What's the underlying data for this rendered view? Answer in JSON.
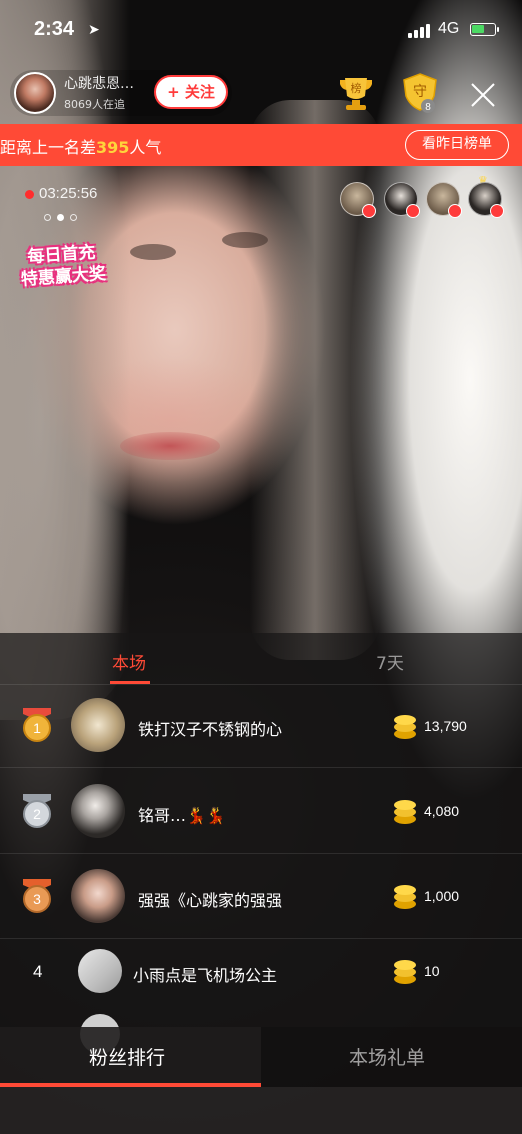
{
  "status_bar": {
    "time": "2:34",
    "network": "4G",
    "location_icon": "location-arrow-icon"
  },
  "host": {
    "name": "心跳悲恩…",
    "followers": "8069人在追",
    "follow_label": "+ 关注"
  },
  "header_icons": {
    "rank_icon_label": "榜",
    "guard_icon_label": "守",
    "guard_count": "8"
  },
  "banner": {
    "prefix": "距离上一名差",
    "number": "395",
    "suffix": "人气",
    "button_label": "看昨日榜单",
    "color": "#ff4a36"
  },
  "live": {
    "elapsed": "03:25:56"
  },
  "promo": {
    "line1": "每日首充",
    "line2": "特惠赢大奖"
  },
  "panel": {
    "tabs": [
      "本场",
      "7天"
    ],
    "active_tab": 0,
    "rows": [
      {
        "rank": "1",
        "medal": "gold",
        "name": "铁打汉子不锈钢的心",
        "value": "13,790"
      },
      {
        "rank": "2",
        "medal": "silver",
        "name": "铭哥…💃💃",
        "value": "4,080"
      },
      {
        "rank": "3",
        "medal": "bronze",
        "name": "强强《心跳家的强强",
        "value": "1,000"
      },
      {
        "rank": "4",
        "medal": "none",
        "name": "小雨点是飞机场公主",
        "value": "10"
      }
    ]
  },
  "bottom_tabs": [
    "粉丝排行",
    "本场礼单"
  ],
  "accent_color": "#ff4a36"
}
